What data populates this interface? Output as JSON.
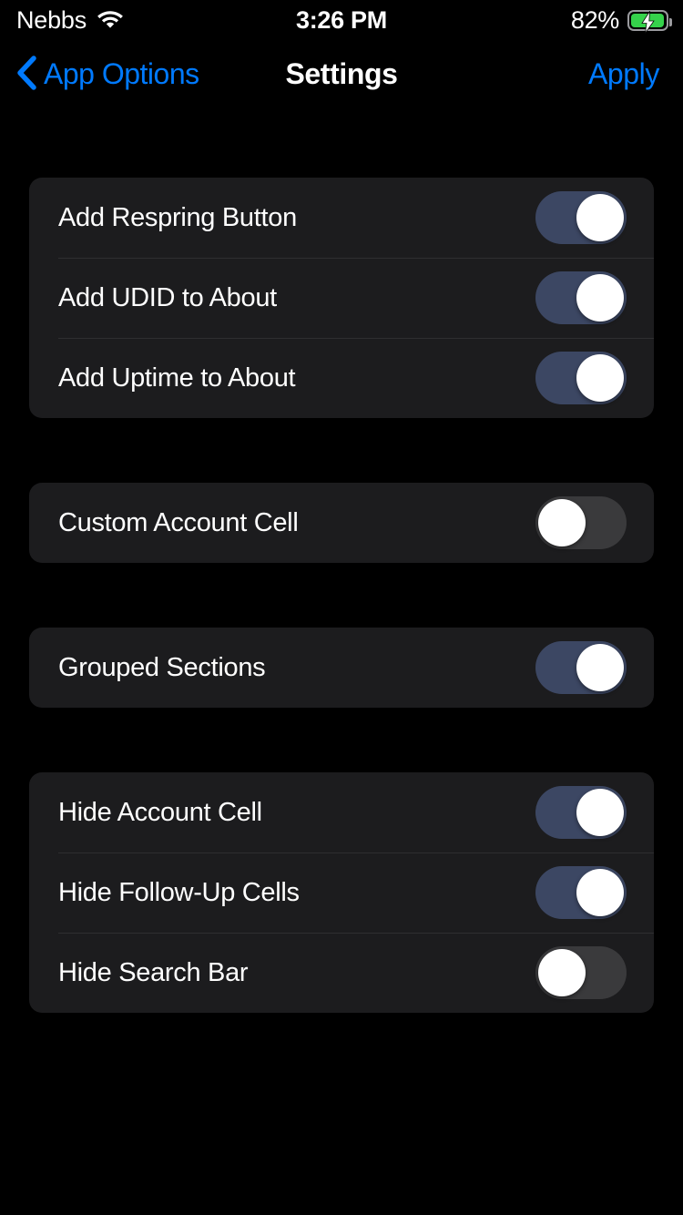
{
  "status_bar": {
    "carrier": "Nebbs",
    "wifi_icon": "wifi-icon",
    "time": "3:26 PM",
    "battery_percent": "82%",
    "battery_icon": "battery-charging-icon",
    "battery_color": "#35d24b"
  },
  "nav_bar": {
    "back_icon": "chevron-left-icon",
    "back_label": "App Options",
    "title": "Settings",
    "apply_label": "Apply",
    "accent_color": "#007aff"
  },
  "theme": {
    "background": "#000000",
    "card_background": "#1c1c1e",
    "separator": "#2e2e30",
    "toggle_on_track": "#3c4763",
    "toggle_off_track": "#3a3a3c",
    "toggle_knob": "#ffffff",
    "label_color": "#ffffff"
  },
  "sections": [
    {
      "rows": [
        {
          "label": "Add Respring Button",
          "state": "on"
        },
        {
          "label": "Add UDID to About",
          "state": "on"
        },
        {
          "label": "Add Uptime to About",
          "state": "on"
        }
      ]
    },
    {
      "rows": [
        {
          "label": "Custom Account Cell",
          "state": "off"
        }
      ]
    },
    {
      "rows": [
        {
          "label": "Grouped Sections",
          "state": "on"
        }
      ]
    },
    {
      "rows": [
        {
          "label": "Hide Account Cell",
          "state": "on"
        },
        {
          "label": "Hide Follow-Up Cells",
          "state": "on"
        },
        {
          "label": "Hide Search Bar",
          "state": "off"
        }
      ]
    }
  ]
}
